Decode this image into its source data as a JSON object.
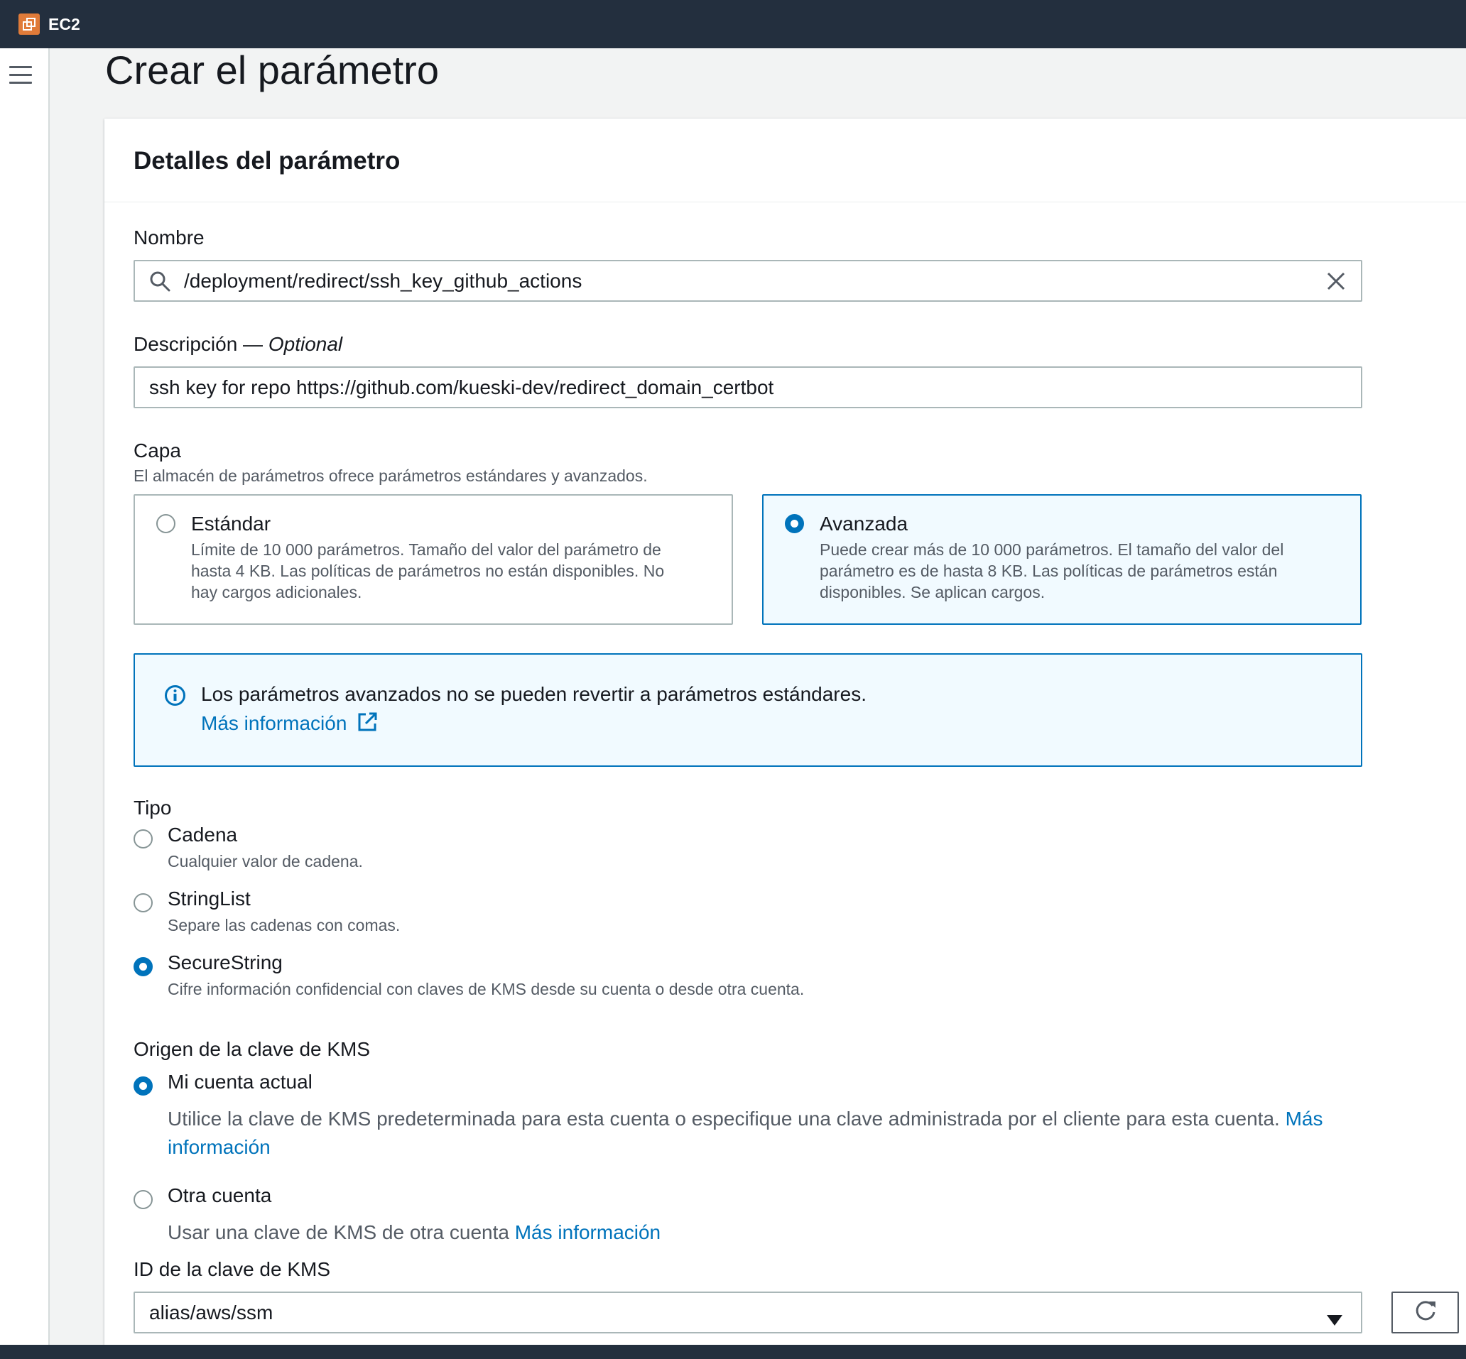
{
  "topbar": {
    "service_name": "EC2",
    "service_icon": "ec2-service-icon"
  },
  "page": {
    "title": "Crear el parámetro"
  },
  "container": {
    "header": "Detalles del parámetro"
  },
  "name_field": {
    "label": "Nombre",
    "value": "/deployment/redirect/ssh_key_github_actions",
    "icons": [
      "search-icon",
      "clear-icon"
    ]
  },
  "description_field": {
    "label": "Descripción — ",
    "optional": "Optional",
    "value": "ssh key for repo https://github.com/kueski-dev/redirect_domain_certbot"
  },
  "tier": {
    "label": "Capa",
    "hint": "El almacén de parámetros ofrece parámetros estándares y avanzados.",
    "options": [
      {
        "title": "Estándar",
        "desc_line1": "Límite de 10 000 parámetros. Tamaño del valor del parámetro de",
        "desc_line2": "hasta 4 KB. Las políticas de parámetros no están disponibles. No",
        "desc_line3": "hay cargos adicionales.",
        "selected": false
      },
      {
        "title": "Avanzada",
        "desc_line1": "Puede crear más de 10 000 parámetros. El tamaño del valor del",
        "desc_line2": "parámetro es de hasta 8 KB. Las políticas de parámetros están",
        "desc_line3": "disponibles. Se aplican cargos.",
        "selected": true
      }
    ]
  },
  "info_alert": {
    "text": "Los parámetros avanzados no se pueden revertir a parámetros estándares.",
    "link": "Más información",
    "icons": [
      "info-icon",
      "external-link-icon"
    ]
  },
  "type": {
    "label": "Tipo",
    "options": [
      {
        "title": "Cadena",
        "desc": "Cualquier valor de cadena.",
        "selected": false
      },
      {
        "title": "StringList",
        "desc": "Separe las cadenas con comas.",
        "selected": false
      },
      {
        "title": "SecureString",
        "desc": "Cifre información confidencial con claves de KMS desde su cuenta o desde otra cuenta.",
        "selected": true
      }
    ]
  },
  "kms_source": {
    "label": "Origen de la clave de KMS",
    "options": [
      {
        "title": "Mi cuenta actual",
        "desc": "Utilice la clave de KMS predeterminada para esta cuenta o especifique una clave administrada por el cliente para esta cuenta. ",
        "link_part1": "Más",
        "link_part2": "información",
        "selected": true
      },
      {
        "title": "Otra cuenta",
        "desc": "Usar una clave de KMS de otra cuenta ",
        "link": "Más información",
        "selected": false
      }
    ]
  },
  "kms_key": {
    "label": "ID de la clave de KMS",
    "value": "alias/aws/ssm",
    "icons": [
      "dropdown-caret-icon",
      "refresh-icon"
    ]
  },
  "colors": {
    "nav_bg": "#232f3e",
    "accent": "#0073bb",
    "info_bg": "#f1faff",
    "service_orange": "#e07b39"
  }
}
